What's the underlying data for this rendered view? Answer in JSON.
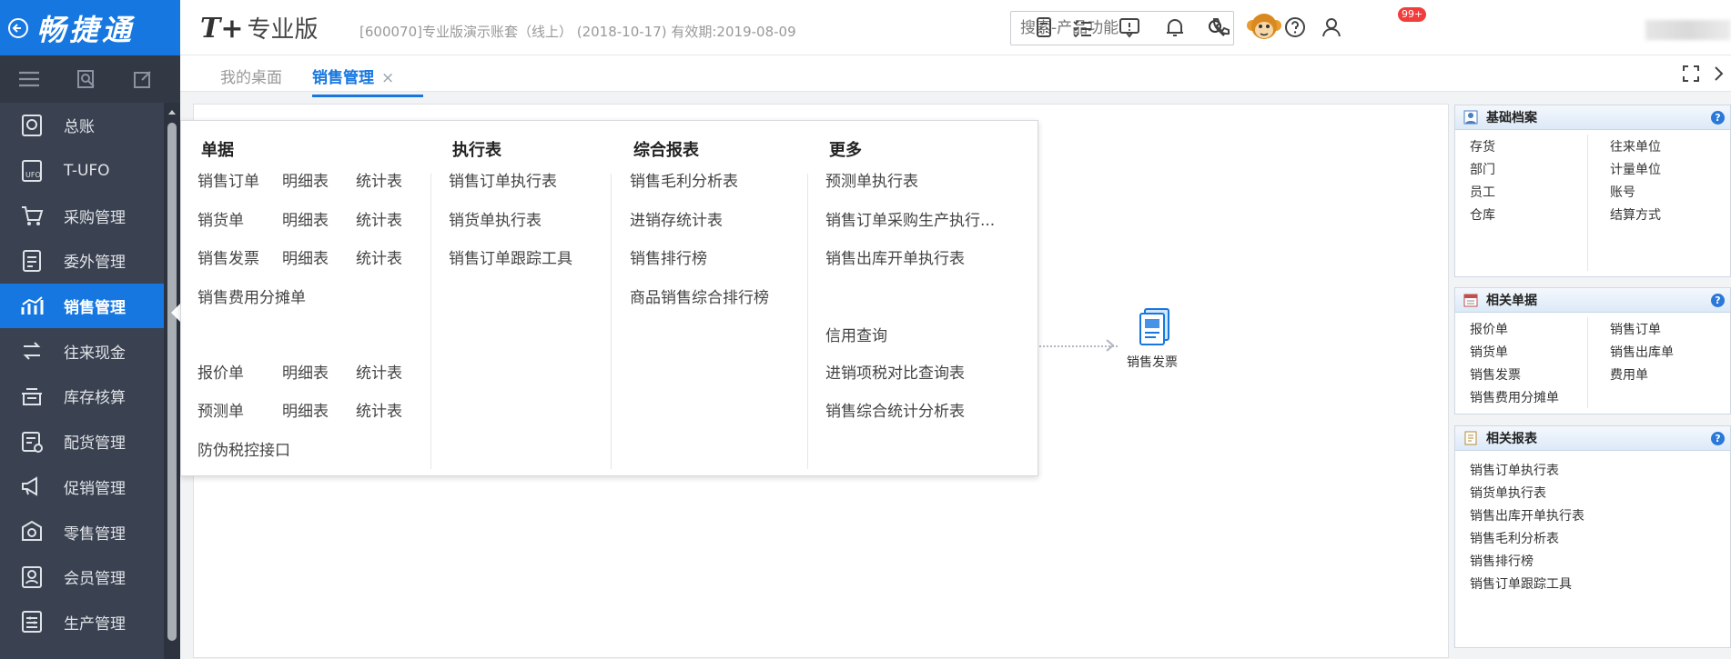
{
  "logo": {
    "text": "畅捷通"
  },
  "header": {
    "product": "T+",
    "edition": "专业版",
    "account_info": "[600070]专业版演示账套（线上） (2018-10-17)   有效期:2019-08-09",
    "search_placeholder": "搜索-产品功能",
    "notification_badge": "99+"
  },
  "sidebar": {
    "items": [
      {
        "label": "总账",
        "icon": "ledger-icon"
      },
      {
        "label": "T-UFO",
        "icon": "ufo-icon"
      },
      {
        "label": "采购管理",
        "icon": "purchase-icon"
      },
      {
        "label": "委外管理",
        "icon": "outsourcing-icon"
      },
      {
        "label": "销售管理",
        "icon": "sales-chart-icon",
        "active": true
      },
      {
        "label": "往来现金",
        "icon": "cash-flow-icon"
      },
      {
        "label": "库存核算",
        "icon": "inventory-icon"
      },
      {
        "label": "配货管理",
        "icon": "distribution-icon"
      },
      {
        "label": "促销管理",
        "icon": "promotion-icon"
      },
      {
        "label": "零售管理",
        "icon": "retail-icon"
      },
      {
        "label": "会员管理",
        "icon": "member-icon"
      },
      {
        "label": "生产管理",
        "icon": "production-icon"
      }
    ]
  },
  "tabs": [
    {
      "label": "我的桌面",
      "active": false
    },
    {
      "label": "销售管理",
      "active": true,
      "close": "×"
    }
  ],
  "menu": {
    "columns": [
      {
        "header": "单据",
        "rows": [
          [
            "销售订单",
            "明细表",
            "统计表"
          ],
          [
            "销货单",
            "明细表",
            "统计表"
          ],
          [
            "销售发票",
            "明细表",
            "统计表"
          ],
          [
            "销售费用分摊单"
          ],
          [
            "报价单",
            "明细表",
            "统计表"
          ],
          [
            "预测单",
            "明细表",
            "统计表"
          ],
          [
            "防伪税控接口"
          ]
        ]
      },
      {
        "header": "执行表",
        "items": [
          "销售订单执行表",
          "销货单执行表",
          "销售订单跟踪工具"
        ]
      },
      {
        "header": "综合报表",
        "items": [
          "销售毛利分析表",
          "进销存统计表",
          "销售排行榜",
          "商品销售综合排行榜"
        ]
      },
      {
        "header": "更多",
        "items": [
          "预测单执行表",
          "销售订单采购生产执行...",
          "销售出库开单执行表",
          "信用查询",
          "进销项税对比查询表",
          "销售综合统计分析表"
        ]
      }
    ]
  },
  "workflow": {
    "node_label": "销售发票"
  },
  "panels": {
    "basic": {
      "title": "基础档案",
      "left": [
        "存货",
        "部门",
        "员工",
        "仓库"
      ],
      "right": [
        "往来单位",
        "计量单位",
        "账号",
        "结算方式"
      ]
    },
    "docs": {
      "title": "相关单据",
      "left": [
        "报价单",
        "销货单",
        "销售发票",
        "销售费用分摊单"
      ],
      "right": [
        "销售订单",
        "销售出库单",
        "费用单"
      ]
    },
    "reports": {
      "title": "相关报表",
      "items": [
        "销售订单执行表",
        "销货单执行表",
        "销售出库开单执行表",
        "销售毛利分析表",
        "销售排行榜",
        "销售订单跟踪工具"
      ]
    },
    "help_label": "?"
  },
  "colors": {
    "accent": "#1777e0",
    "sidebar_bg": "#3a4150",
    "badge": "#f23d3d"
  }
}
